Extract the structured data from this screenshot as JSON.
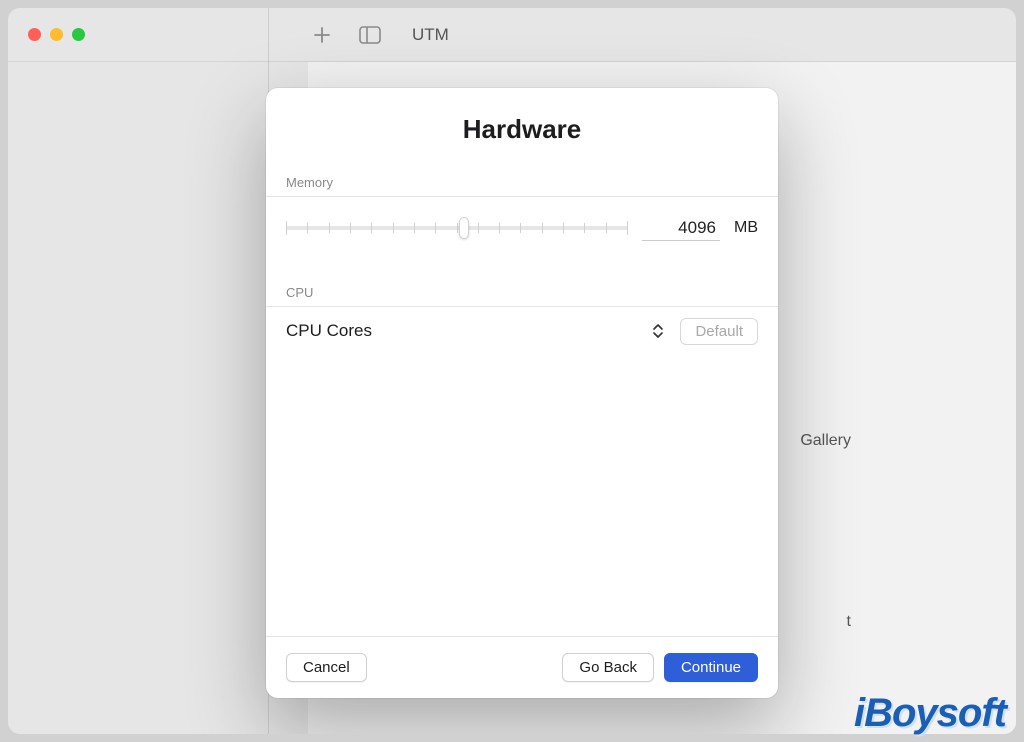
{
  "toolbar": {
    "app_title": "UTM"
  },
  "background": {
    "gallery_label": "Gallery",
    "t_label": "t"
  },
  "modal": {
    "title": "Hardware",
    "memory": {
      "section_label": "Memory",
      "value": "4096",
      "unit": "MB",
      "slider_percent": 52
    },
    "cpu": {
      "section_label": "CPU",
      "cores_label": "CPU Cores",
      "default_button": "Default"
    },
    "footer": {
      "cancel": "Cancel",
      "go_back": "Go Back",
      "continue": "Continue"
    }
  },
  "watermark": "iBoysoft"
}
